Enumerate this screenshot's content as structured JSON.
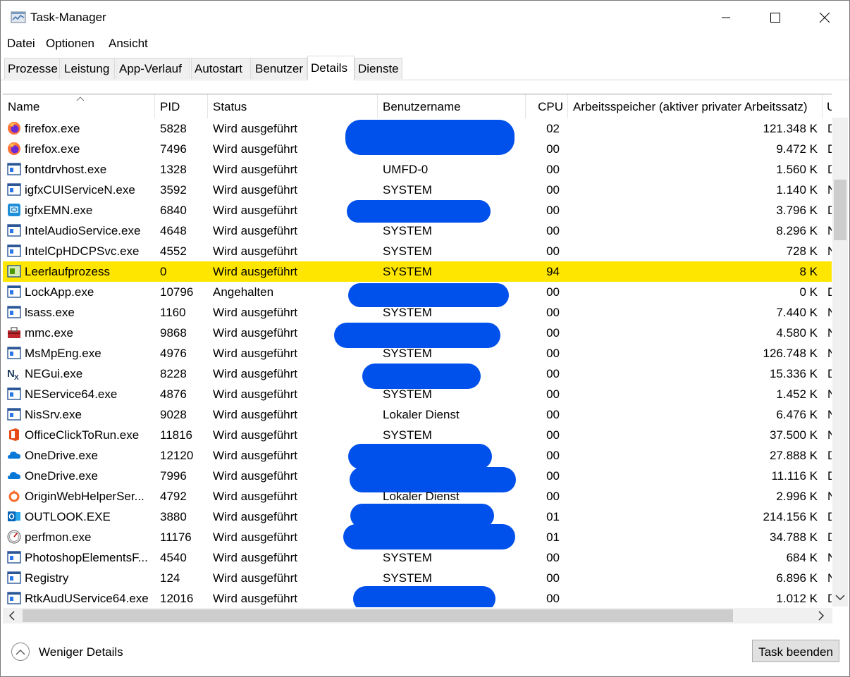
{
  "window": {
    "title": "Task-Manager"
  },
  "menu": [
    "Datei",
    "Optionen",
    "Ansicht"
  ],
  "tabs": [
    "Prozesse",
    "Leistung",
    "App-Verlauf",
    "Autostart",
    "Benutzer",
    "Details",
    "Dienste"
  ],
  "active_tab": "Details",
  "columns": [
    "Name",
    "PID",
    "Status",
    "Benutzername",
    "CPU",
    "Arbeitsspeicher (aktiver privater Arbeitssatz)",
    "U"
  ],
  "rows": [
    {
      "name": "firefox.exe",
      "pid": "5828",
      "status": "Wird ausgeführt",
      "user": "",
      "cpu": "02",
      "mem": "121.348 K",
      "extra": "D",
      "icon": "firefox-icon"
    },
    {
      "name": "firefox.exe",
      "pid": "7496",
      "status": "Wird ausgeführt",
      "user": "",
      "cpu": "00",
      "mem": "9.472 K",
      "extra": "D",
      "icon": "firefox-icon"
    },
    {
      "name": "fontdrvhost.exe",
      "pid": "1328",
      "status": "Wird ausgeführt",
      "user": "UMFD-0",
      "cpu": "00",
      "mem": "1.560 K",
      "extra": "D",
      "icon": "app-window-icon"
    },
    {
      "name": "igfxCUIServiceN.exe",
      "pid": "3592",
      "status": "Wird ausgeführt",
      "user": "SYSTEM",
      "cpu": "00",
      "mem": "1.140 K",
      "extra": "N",
      "icon": "app-window-icon"
    },
    {
      "name": "igfxEMN.exe",
      "pid": "6840",
      "status": "Wird ausgeführt",
      "user": "",
      "cpu": "00",
      "mem": "3.796 K",
      "extra": "D",
      "icon": "intel-graphics-icon"
    },
    {
      "name": "IntelAudioService.exe",
      "pid": "4648",
      "status": "Wird ausgeführt",
      "user": "SYSTEM",
      "cpu": "00",
      "mem": "8.296 K",
      "extra": "N",
      "icon": "app-window-icon"
    },
    {
      "name": "IntelCpHDCPSvc.exe",
      "pid": "4552",
      "status": "Wird ausgeführt",
      "user": "SYSTEM",
      "cpu": "00",
      "mem": "728 K",
      "extra": "N",
      "icon": "app-window-icon"
    },
    {
      "name": "Leerlaufprozess",
      "pid": "0",
      "status": "Wird ausgeführt",
      "user": "SYSTEM",
      "cpu": "94",
      "mem": "8 K",
      "extra": "",
      "icon": "idle-process-icon",
      "highlight": true
    },
    {
      "name": "LockApp.exe",
      "pid": "10796",
      "status": "Angehalten",
      "user": "",
      "cpu": "00",
      "mem": "0 K",
      "extra": "D",
      "icon": "app-window-icon"
    },
    {
      "name": "lsass.exe",
      "pid": "1160",
      "status": "Wird ausgeführt",
      "user": "SYSTEM",
      "cpu": "00",
      "mem": "7.440 K",
      "extra": "N",
      "icon": "app-window-icon"
    },
    {
      "name": "mmc.exe",
      "pid": "9868",
      "status": "Wird ausgeführt",
      "user": "",
      "cpu": "00",
      "mem": "4.580 K",
      "extra": "N",
      "icon": "toolbox-icon"
    },
    {
      "name": "MsMpEng.exe",
      "pid": "4976",
      "status": "Wird ausgeführt",
      "user": "SYSTEM",
      "cpu": "00",
      "mem": "126.748 K",
      "extra": "N",
      "icon": "app-window-icon"
    },
    {
      "name": "NEGui.exe",
      "pid": "8228",
      "status": "Wird ausgeführt",
      "user": "",
      "cpu": "00",
      "mem": "15.336 K",
      "extra": "D",
      "icon": "nx-icon"
    },
    {
      "name": "NEService64.exe",
      "pid": "4876",
      "status": "Wird ausgeführt",
      "user": "SYSTEM",
      "cpu": "00",
      "mem": "1.452 K",
      "extra": "N",
      "icon": "app-window-icon"
    },
    {
      "name": "NisSrv.exe",
      "pid": "9028",
      "status": "Wird ausgeführt",
      "user": "Lokaler Dienst",
      "cpu": "00",
      "mem": "6.476 K",
      "extra": "N",
      "icon": "app-window-icon"
    },
    {
      "name": "OfficeClickToRun.exe",
      "pid": "11816",
      "status": "Wird ausgeführt",
      "user": "SYSTEM",
      "cpu": "00",
      "mem": "37.500 K",
      "extra": "N",
      "icon": "office-icon"
    },
    {
      "name": "OneDrive.exe",
      "pid": "12120",
      "status": "Wird ausgeführt",
      "user": "",
      "cpu": "00",
      "mem": "27.888 K",
      "extra": "D",
      "icon": "onedrive-icon"
    },
    {
      "name": "OneDrive.exe",
      "pid": "7996",
      "status": "Wird ausgeführt",
      "user": "",
      "cpu": "00",
      "mem": "11.116 K",
      "extra": "D",
      "icon": "onedrive-icon"
    },
    {
      "name": "OriginWebHelperSer...",
      "pid": "4792",
      "status": "Wird ausgeführt",
      "user": "Lokaler Dienst",
      "cpu": "00",
      "mem": "2.996 K",
      "extra": "N",
      "icon": "origin-icon"
    },
    {
      "name": "OUTLOOK.EXE",
      "pid": "3880",
      "status": "Wird ausgeführt",
      "user": "",
      "cpu": "01",
      "mem": "214.156 K",
      "extra": "D",
      "icon": "outlook-icon"
    },
    {
      "name": "perfmon.exe",
      "pid": "11176",
      "status": "Wird ausgeführt",
      "user": "",
      "cpu": "01",
      "mem": "34.788 K",
      "extra": "D",
      "icon": "perfmon-icon"
    },
    {
      "name": "PhotoshopElementsF...",
      "pid": "4540",
      "status": "Wird ausgeführt",
      "user": "SYSTEM",
      "cpu": "00",
      "mem": "684 K",
      "extra": "N",
      "icon": "app-window-icon"
    },
    {
      "name": "Registry",
      "pid": "124",
      "status": "Wird ausgeführt",
      "user": "SYSTEM",
      "cpu": "00",
      "mem": "6.896 K",
      "extra": "N",
      "icon": "app-window-icon"
    },
    {
      "name": "RtkAudUService64.exe",
      "pid": "12016",
      "status": "Wird ausgeführt",
      "user": "",
      "cpu": "00",
      "mem": "1.012 K",
      "extra": "D",
      "icon": "app-window-icon"
    }
  ],
  "footer": {
    "fewer_details": "Weniger Details",
    "end_task": "Task beenden"
  },
  "colors": {
    "highlight": "#ffe600",
    "redaction": "#0050ec"
  }
}
